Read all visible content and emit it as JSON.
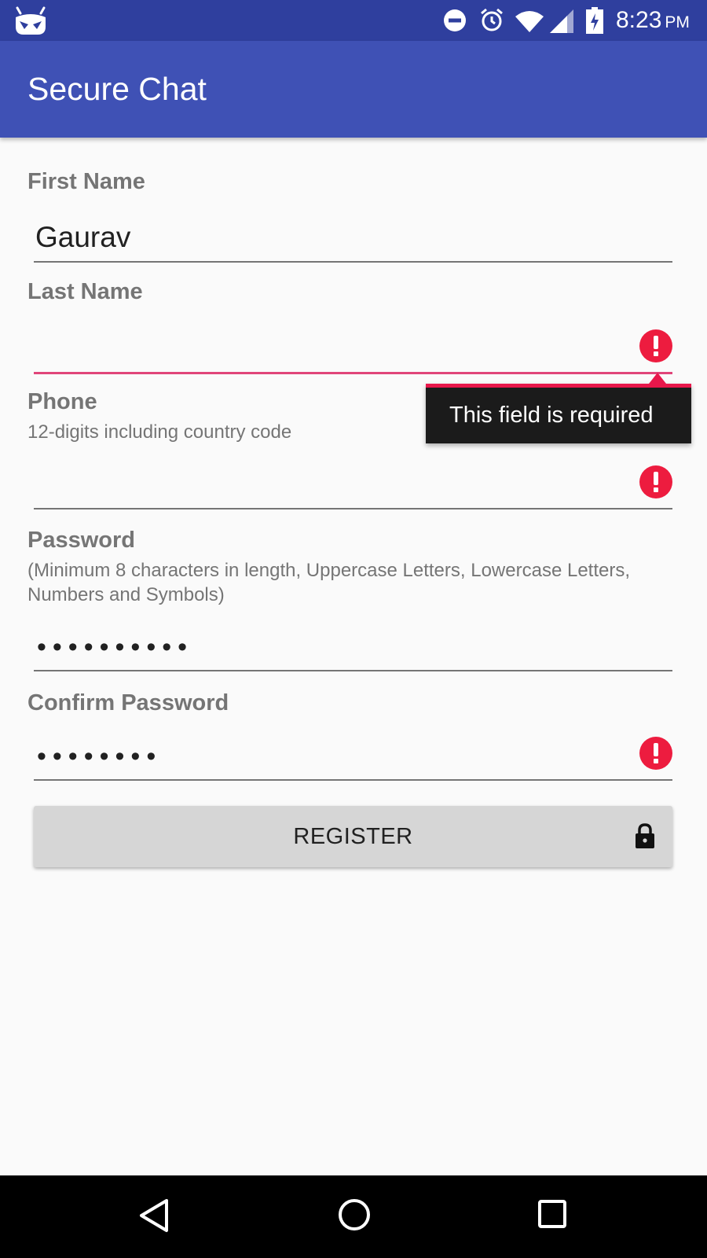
{
  "status_bar": {
    "time": "8:23",
    "ampm": "PM",
    "icons": [
      "cyanogen-robot-icon",
      "do-not-disturb-icon",
      "alarm-icon",
      "wifi-icon",
      "cell-signal-icon",
      "battery-icon"
    ]
  },
  "app_bar": {
    "title": "Secure Chat"
  },
  "form": {
    "first_name": {
      "label": "First Name",
      "value": "Gaurav"
    },
    "last_name": {
      "label": "Last Name",
      "value": "",
      "error": "This field is required"
    },
    "phone": {
      "label": "Phone",
      "hint": "12-digits including country code",
      "value": ""
    },
    "password": {
      "label": "Password",
      "hint": "(Minimum 8 characters in length, Uppercase Letters, Lowercase Letters, Numbers and Symbols)",
      "masked": "••••••••••"
    },
    "confirm_password": {
      "label": "Confirm Password",
      "masked": "••••••••"
    },
    "register_label": "REGISTER"
  },
  "colors": {
    "status_bar": "#2f3f9e",
    "app_bar": "#3f51b5",
    "error": "#ed1c3f",
    "error_underline": "#e0457a",
    "background": "#fafafa"
  }
}
